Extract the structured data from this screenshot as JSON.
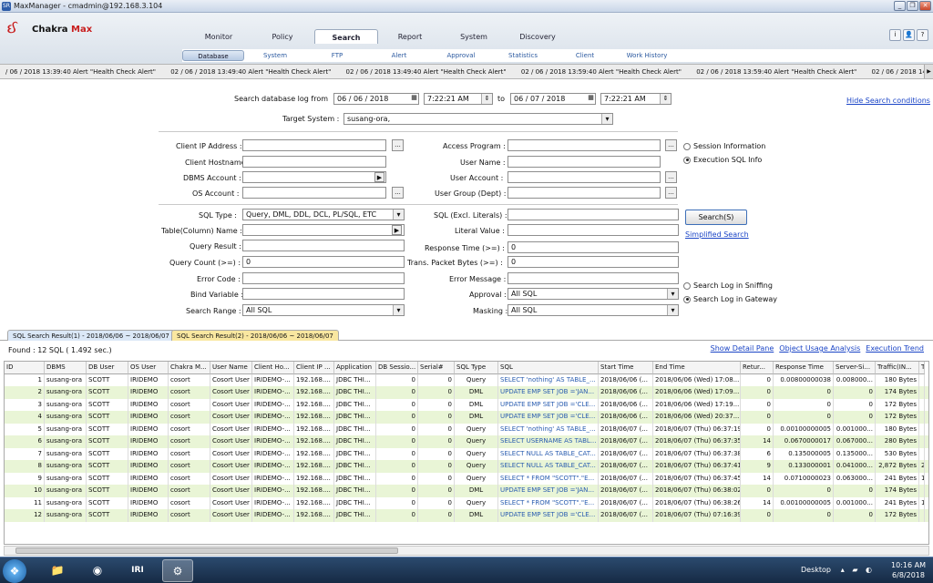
{
  "window": {
    "title": "MaxManager - cmadmin@192.168.3.104",
    "buttons": [
      "_",
      "❐",
      "✕"
    ]
  },
  "logo": {
    "text_a": "Chakra ",
    "text_b": "Max"
  },
  "header_buttons": [
    "i",
    "👤",
    "?"
  ],
  "main_tabs": [
    "Monitor",
    "Policy",
    "Search",
    "Report",
    "System",
    "Discovery"
  ],
  "sub_tabs": [
    "Database",
    "System",
    "FTP",
    "Alert",
    "Approval",
    "Statistics",
    "Client",
    "Work History"
  ],
  "ticker": [
    "/ 06 / 2018 13:39:40 Alert \"Health Check Alert\"",
    "02 / 06 / 2018 13:49:40 Alert \"Health Check Alert\"",
    "02 / 06 / 2018 13:49:40 Alert \"Health Check Alert\"",
    "02 / 06 / 2018 13:59:40 Alert \"Health Check Alert\"",
    "02 / 06 / 2018 13:59:40 Alert \"Health Check Alert\"",
    "02 / 06 / 2018 14:09:40 Alert \"H"
  ],
  "form": {
    "search_from_label": "Search database log from",
    "date_from": "06 / 06 / 2018",
    "time_from": "7:22:21 AM",
    "to_label": "to",
    "date_to": "06 / 07 / 2018",
    "time_to": "7:22:21 AM",
    "hide_link": "Hide Search conditions",
    "target_label": "Target System :",
    "target_value": "susang-ora,",
    "client_ip_label": "Client IP Address :",
    "client_host_label": "Client Hostname :",
    "dbms_account_label": "DBMS Account :",
    "os_account_label": "OS Account :",
    "access_program_label": "Access Program :",
    "user_name_label": "User Name :",
    "user_account_label": "User Account :",
    "user_group_label": "User Group (Dept) :",
    "radio_session": "Session Information",
    "radio_sql": "Execution SQL Info",
    "sql_type_label": "SQL Type :",
    "sql_type_value": "Query, DML, DDL, DCL, PL/SQL, ETC",
    "table_label": "Table(Column) Name :",
    "query_result_label": "Query Result :",
    "query_count_label": "Query Count (>=) :",
    "query_count_value": "0",
    "error_code_label": "Error Code :",
    "bind_var_label": "Bind Variable :",
    "search_range_label": "Search Range :",
    "search_range_value": "All SQL",
    "sql_excl_label": "SQL (Excl. Literals) :",
    "literal_label": "Literal Value :",
    "response_label": "Response Time (>=) :",
    "response_value": "0",
    "trans_label": "Trans. Packet Bytes (>=) :",
    "trans_value": "0",
    "error_msg_label": "Error Message :",
    "approval_label": "Approval :",
    "approval_value": "All SQL",
    "masking_label": "Masking :",
    "masking_value": "All SQL",
    "search_button": "Search(S)",
    "simplified_link": "Simplified Search",
    "radio_sniffing": "Search Log in Sniffing",
    "radio_gateway": "Search Log in Gateway",
    "browse": "...",
    "arrow": "▶"
  },
  "result_tabs": [
    "SQL Search Result(1) - 2018/06/06 ~ 2018/06/07",
    "SQL Search Result(2) - 2018/06/06 ~ 2018/06/07"
  ],
  "found": "Found : 12 SQL ( 1.492 sec.)",
  "result_links": [
    "Show Detail Pane",
    "Object Usage Analysis",
    "Execution Trend"
  ],
  "columns": [
    "ID",
    "DBMS",
    "DB User",
    "OS User",
    "Chakra M...",
    "User Name",
    "Client Ho...",
    "Client IP ...",
    "Application",
    "DB Sessio...",
    "Serial#",
    "SQL Type",
    "SQL",
    "Start Time",
    "End Time",
    "Retur...",
    "Response Time",
    "Server-Si...",
    "Traffic(IN...",
    "T"
  ],
  "rows": [
    [
      "1",
      "susang-ora",
      "SCOTT",
      "IRIDEMO",
      "cosort",
      "Cosort User",
      "IRIDEMO-...",
      "192.168....",
      "JDBC THI...",
      "0",
      "0",
      "Query",
      "SELECT 'nothing' AS TABLE_...",
      "2018/06/06 (...",
      "2018/06/06 (Wed) 17:08...",
      "0",
      "0.00800000038",
      "0.008000...",
      "180 Bytes",
      ""
    ],
    [
      "2",
      "susang-ora",
      "SCOTT",
      "IRIDEMO",
      "cosort",
      "Cosort User",
      "IRIDEMO-...",
      "192.168....",
      "JDBC THI...",
      "0",
      "0",
      "DML",
      "UPDATE EMP SET JOB ='JAN...",
      "2018/06/06 (...",
      "2018/06/06 (Wed) 17:09...",
      "0",
      "0",
      "0",
      "174 Bytes",
      ""
    ],
    [
      "3",
      "susang-ora",
      "SCOTT",
      "IRIDEMO",
      "cosort",
      "Cosort User",
      "IRIDEMO-...",
      "192.168....",
      "JDBC THI...",
      "0",
      "0",
      "DML",
      "UPDATE EMP SET JOB ='CLE...",
      "2018/06/06 (...",
      "2018/06/06 (Wed) 17:19...",
      "0",
      "0",
      "0",
      "172 Bytes",
      ""
    ],
    [
      "4",
      "susang-ora",
      "SCOTT",
      "IRIDEMO",
      "cosort",
      "Cosort User",
      "IRIDEMO-...",
      "192.168....",
      "JDBC THI...",
      "0",
      "0",
      "DML",
      "UPDATE EMP SET JOB ='CLE...",
      "2018/06/06 (...",
      "2018/06/06 (Wed) 20:37...",
      "0",
      "0",
      "0",
      "172 Bytes",
      ""
    ],
    [
      "5",
      "susang-ora",
      "SCOTT",
      "IRIDEMO",
      "cosort",
      "Cosort User",
      "IRIDEMO-...",
      "192.168....",
      "JDBC THI...",
      "0",
      "0",
      "Query",
      "SELECT 'nothing' AS TABLE_...",
      "2018/06/07 (...",
      "2018/06/07 (Thu) 06:37:19",
      "0",
      "0.00100000005",
      "0.001000...",
      "180 Bytes",
      ""
    ],
    [
      "6",
      "susang-ora",
      "SCOTT",
      "IRIDEMO",
      "cosort",
      "Cosort User",
      "IRIDEMO-...",
      "192.168....",
      "JDBC THI...",
      "0",
      "0",
      "Query",
      "SELECT USERNAME AS TABL...",
      "2018/06/07 (...",
      "2018/06/07 (Thu) 06:37:35",
      "14",
      "0.0670000017",
      "0.067000...",
      "280 Bytes",
      ""
    ],
    [
      "7",
      "susang-ora",
      "SCOTT",
      "IRIDEMO",
      "cosort",
      "Cosort User",
      "IRIDEMO-...",
      "192.168....",
      "JDBC THI...",
      "0",
      "0",
      "Query",
      "SELECT NULL AS TABLE_CAT...",
      "2018/06/07 (...",
      "2018/06/07 (Thu) 06:37:38",
      "6",
      "0.135000005",
      "0.135000...",
      "530 Bytes",
      ""
    ],
    [
      "8",
      "susang-ora",
      "SCOTT",
      "IRIDEMO",
      "cosort",
      "Cosort User",
      "IRIDEMO-...",
      "192.168....",
      "JDBC THI...",
      "0",
      "0",
      "Query",
      "SELECT NULL AS TABLE_CAT...",
      "2018/06/07 (...",
      "2018/06/07 (Thu) 06:37:41",
      "9",
      "0.133000001",
      "0.041000...",
      "2,872 Bytes",
      "2"
    ],
    [
      "9",
      "susang-ora",
      "SCOTT",
      "IRIDEMO",
      "cosort",
      "Cosort User",
      "IRIDEMO-...",
      "192.168....",
      "JDBC THI...",
      "0",
      "0",
      "Query",
      "SELECT * FROM \"SCOTT\".\"E...",
      "2018/06/07 (...",
      "2018/06/07 (Thu) 06:37:45",
      "14",
      "0.0710000023",
      "0.063000...",
      "241 Bytes",
      "1"
    ],
    [
      "10",
      "susang-ora",
      "SCOTT",
      "IRIDEMO",
      "cosort",
      "Cosort User",
      "IRIDEMO-...",
      "192.168....",
      "JDBC THI...",
      "0",
      "0",
      "DML",
      "UPDATE EMP SET JOB ='JAN...",
      "2018/06/07 (...",
      "2018/06/07 (Thu) 06:38:02",
      "0",
      "0",
      "0",
      "174 Bytes",
      ""
    ],
    [
      "11",
      "susang-ora",
      "SCOTT",
      "IRIDEMO",
      "cosort",
      "Cosort User",
      "IRIDEMO-...",
      "192.168....",
      "JDBC THI...",
      "0",
      "0",
      "Query",
      "SELECT * FROM \"SCOTT\".\"E...",
      "2018/06/07 (...",
      "2018/06/07 (Thu) 06:38:26",
      "14",
      "0.00100000005",
      "0.001000...",
      "241 Bytes",
      "1"
    ],
    [
      "12",
      "susang-ora",
      "SCOTT",
      "IRIDEMO",
      "cosort",
      "Cosort User",
      "IRIDEMO-...",
      "192.168....",
      "JDBC THI...",
      "0",
      "0",
      "DML",
      "UPDATE EMP SET JOB ='CLE...",
      "2018/06/07 (...",
      "2018/06/07 (Thu) 07:16:39",
      "0",
      "0",
      "0",
      "172 Bytes",
      ""
    ]
  ],
  "taskbar": {
    "desktop": "Desktop",
    "time": "10:16 AM",
    "date": "6/8/2018",
    "apps": [
      "📁",
      "◉",
      "IRI",
      "⚙"
    ]
  }
}
